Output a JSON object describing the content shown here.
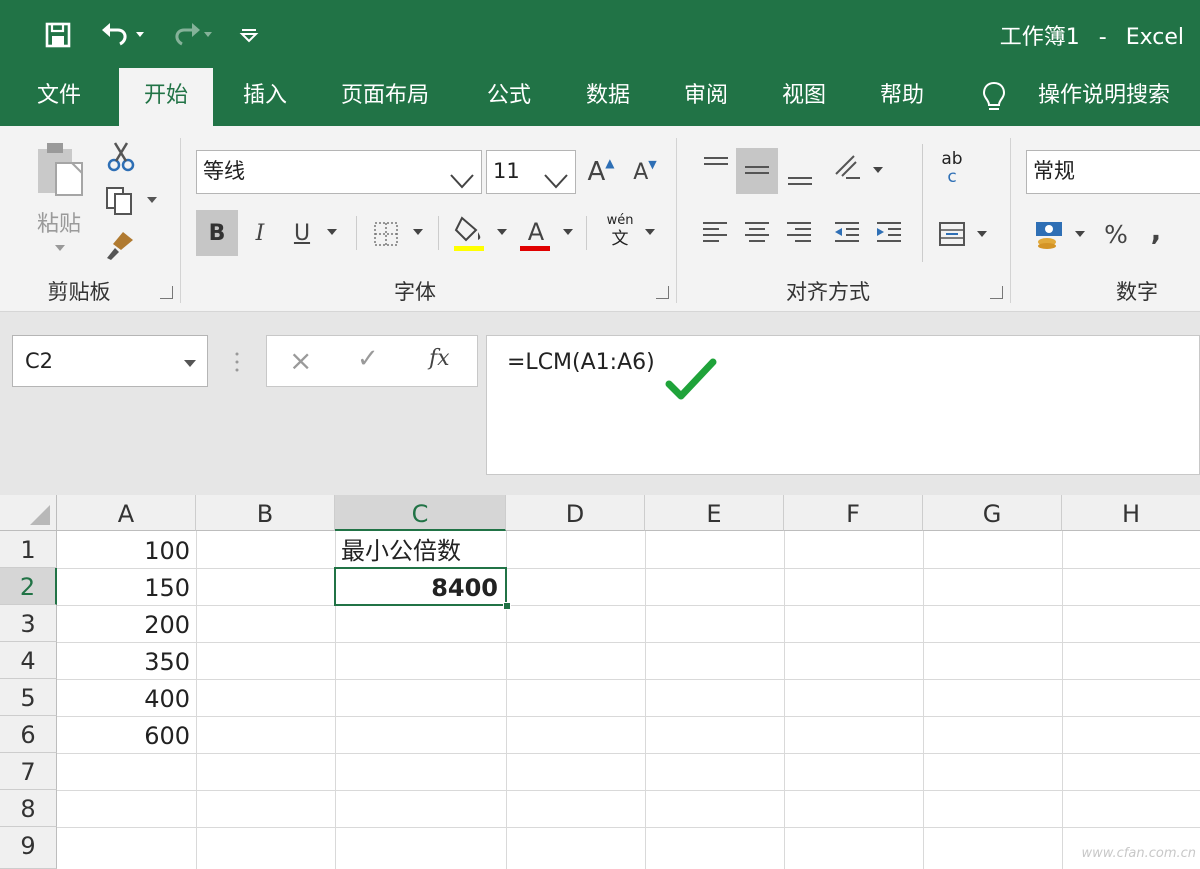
{
  "window": {
    "doc_name": "工作簿1",
    "separator": "-",
    "app_name": "Excel"
  },
  "quick_access": [
    "save-icon",
    "undo-icon",
    "redo-icon",
    "customize-quick-access-icon"
  ],
  "tabs": [
    "文件",
    "开始",
    "插入",
    "页面布局",
    "公式",
    "数据",
    "审阅",
    "视图",
    "帮助"
  ],
  "active_tab": "开始",
  "tell_me": "操作说明搜索",
  "ribbon": {
    "clipboard": {
      "paste_label": "粘贴",
      "group_label": "剪贴板"
    },
    "font": {
      "name": "等线",
      "size": "11",
      "group_label": "字体",
      "bold": "B",
      "italic": "I",
      "underline": "U",
      "grow": "A",
      "shrink": "A",
      "font_color_glyph": "A",
      "phonetic_top": "wén",
      "phonetic_bottom": "文",
      "font_color_bar": "#e00000",
      "highlight_bar": "#ffff00"
    },
    "alignment": {
      "group_label": "对齐方式",
      "wrap_top": "ab",
      "wrap_bottom": "c"
    },
    "number": {
      "format": "常规",
      "group_label": "数字",
      "percent": "%",
      "comma": ","
    }
  },
  "formula_bar": {
    "name_box": "C2",
    "cancel": "×",
    "enter": "✓",
    "fx": "fx",
    "formula": "=LCM(A1:A6)",
    "check_color": "#1fa33a"
  },
  "sheet": {
    "columns": [
      "A",
      "B",
      "C",
      "D",
      "E",
      "F",
      "G",
      "H"
    ],
    "rows": [
      "1",
      "2",
      "3",
      "4",
      "5",
      "6",
      "7",
      "8",
      "9"
    ],
    "selected_cell": "C2",
    "cells": {
      "A1": "100",
      "A2": "150",
      "A3": "200",
      "A4": "350",
      "A5": "400",
      "A6": "600",
      "C1": "最小公倍数",
      "C2": "8400"
    }
  },
  "watermark": "www.cfan.com.cn",
  "colors": {
    "accent": "#217346",
    "selection": "#217346"
  }
}
